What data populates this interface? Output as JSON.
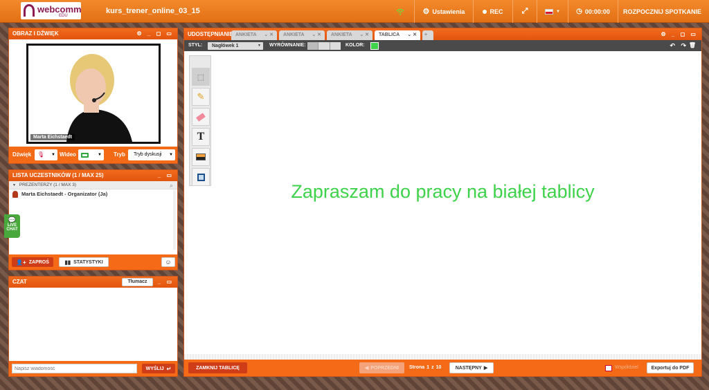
{
  "app": {
    "logo_text": "webcomm",
    "logo_sub": "EDU",
    "room_name": "kurs_trener_online_03_15"
  },
  "topbar": {
    "settings": "Ustawienia",
    "rec": "REC",
    "timer": "00:00:00",
    "start": "ROZPOCZNIJ SPOTKANIE"
  },
  "av_panel": {
    "title": "OBRAZ I DŹWIĘK",
    "video_caption": "Marta Eichstaedt",
    "sound_label": "Dźwięk",
    "video_label": "Wideo",
    "mode_label": "Tryb",
    "mode_value": "Tryb dyskusji"
  },
  "participants": {
    "title": "LISTA UCZESTNIKÓW (1 / MAX 25)",
    "group": "PREZENTERZY (1 / MAX 3)",
    "items": [
      {
        "name": "Marta Eichstaedt - Organizator (Ja)"
      }
    ],
    "invite": "ZAPROŚ",
    "stats": "STATYSTYKI"
  },
  "livechat": {
    "line1": "LIVE",
    "line2": "CHAT"
  },
  "chat": {
    "title": "CZAT",
    "translate": "Tłumacz",
    "placeholder": "Napisz wiadomość",
    "send": "WYŚLIJ"
  },
  "share": {
    "title": "UDOSTĘPNIANIE",
    "tabs": [
      {
        "label": "ANKIETA"
      },
      {
        "label": "ANKIETA"
      },
      {
        "label": "ANKIETA"
      },
      {
        "label": "TABLICA"
      }
    ]
  },
  "toolbar": {
    "style_label": "STYL:",
    "style_value": "Nagłówek 1",
    "align_label": "WYRÓWNANIE:",
    "color_label": "KOLOR:",
    "color": "#3ed24a"
  },
  "board": {
    "text": "Zapraszam do pracy na białej tablicy"
  },
  "footer": {
    "close": "ZAMKNIJ TABLICĘ",
    "prev": "POPRZEDNI",
    "page": "Strona",
    "page_cur": "1",
    "page_sep": "z",
    "page_total": "10",
    "next": "NASTĘPNY",
    "share": "Współdziel",
    "export": "Exportuj do PDF"
  },
  "colors": {
    "accent": "#f26b1d",
    "brand": "#8c1a52"
  }
}
